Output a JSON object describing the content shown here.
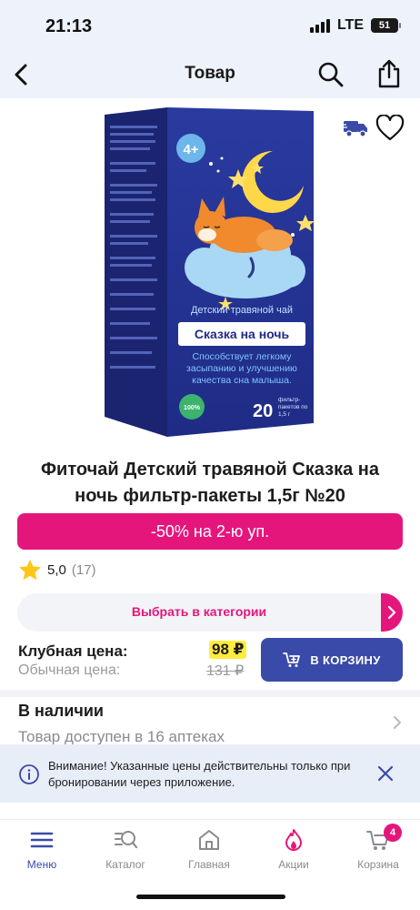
{
  "status_bar": {
    "time": "21:13",
    "network": "LTE",
    "battery": "51"
  },
  "nav": {
    "title": "Товар",
    "back_icon": "chevron-left-icon",
    "search_icon": "search-icon",
    "share_icon": "share-icon"
  },
  "product": {
    "package": {
      "age_badge": "4+",
      "tagline": "Детский травяной чай",
      "name": "Сказка на ночь",
      "benefit": "Способствует легкому засыпанию и улучшению качества сна малыша.",
      "count": "20",
      "count_note": "фильтр-пакетов по 1,5 г",
      "eco_badge": "100%"
    },
    "title": "Фиточай Детский травяной Сказка на ночь фильтр-пакеты 1,5г №20",
    "promo": "-50% на 2-ю уп.",
    "rating": {
      "value": "5,0",
      "count": "(17)"
    },
    "choose_category": "Выбрать в категории"
  },
  "price": {
    "club_label": "Клубная цена:",
    "club_value": "98 ₽",
    "regular_label": "Обычная цена:",
    "regular_value": "131 ₽",
    "cart_button": "В КОРЗИНУ"
  },
  "availability": {
    "title": "В наличии",
    "subtitle": "Товар доступен в 16 аптеках"
  },
  "notice": {
    "text": "Внимание! Указанные цены действительны только при бронировании через приложение."
  },
  "tabs": [
    {
      "label": "Меню",
      "icon": "menu-icon",
      "active": true
    },
    {
      "label": "Каталог",
      "icon": "catalog-search-icon",
      "active": false
    },
    {
      "label": "Главная",
      "icon": "home-icon",
      "active": false
    },
    {
      "label": "Акции",
      "icon": "flame-icon",
      "active": false
    },
    {
      "label": "Корзина",
      "icon": "cart-icon",
      "active": false,
      "badge": "4"
    }
  ],
  "colors": {
    "accent_pink": "#e5167b",
    "primary_blue": "#3a4aa8",
    "price_highlight": "#ffec3d"
  }
}
